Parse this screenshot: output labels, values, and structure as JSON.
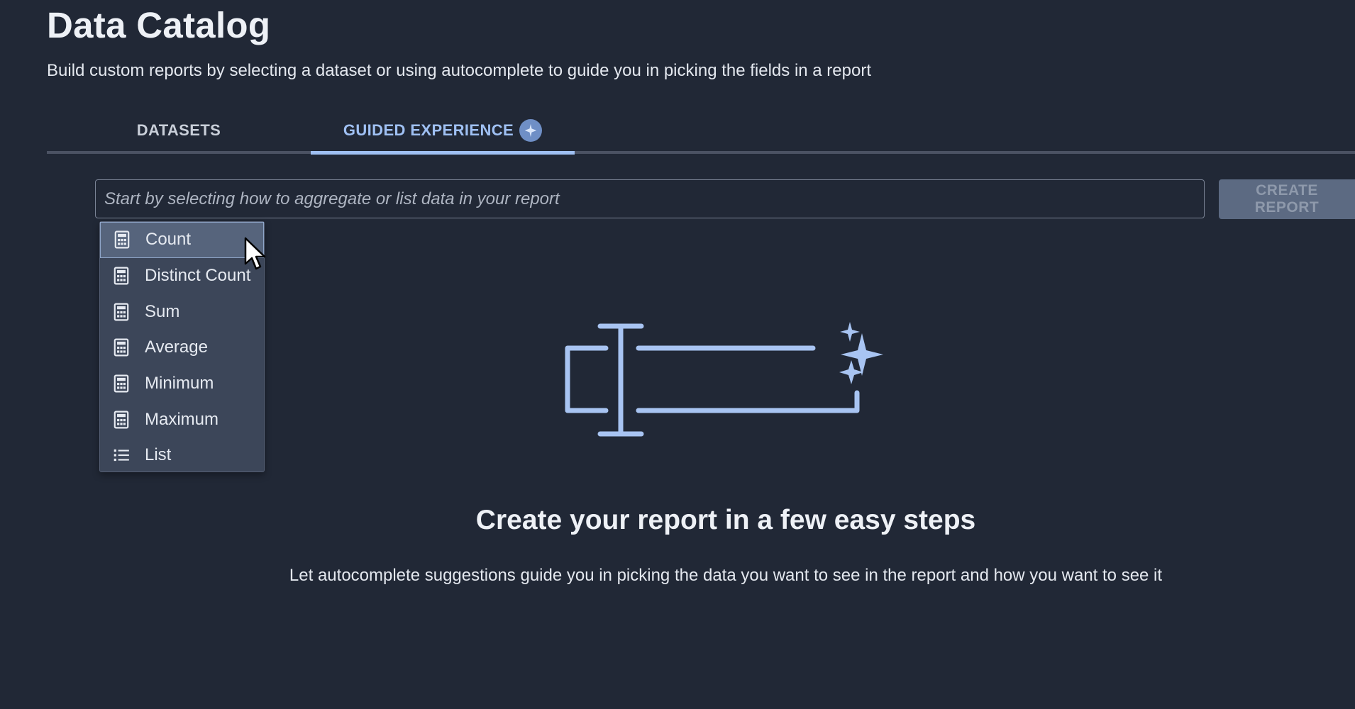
{
  "page": {
    "title": "Data Catalog",
    "subtitle": "Build custom reports by selecting a dataset or using autocomplete to guide you in picking the fields in a report"
  },
  "tabs": [
    {
      "label": "DATASETS",
      "active": false
    },
    {
      "label": "GUIDED EXPERIENCE",
      "active": true,
      "icon": "sparkle-icon"
    }
  ],
  "search": {
    "placeholder": "Start by selecting how to aggregate or list data in your report",
    "value": ""
  },
  "create_button": {
    "label": "CREATE REPORT",
    "disabled": true
  },
  "menu": {
    "items": [
      {
        "label": "Count",
        "icon": "calculator-icon",
        "highlighted": true
      },
      {
        "label": "Distinct Count",
        "icon": "calculator-icon"
      },
      {
        "label": "Sum",
        "icon": "calculator-icon"
      },
      {
        "label": "Average",
        "icon": "calculator-icon"
      },
      {
        "label": "Minimum",
        "icon": "calculator-icon"
      },
      {
        "label": "Maximum",
        "icon": "calculator-icon"
      },
      {
        "label": "List",
        "icon": "list-icon"
      }
    ]
  },
  "empty_state": {
    "illustration": "text-cursor-sparkle-illustration",
    "headline": "Create your report in a few easy steps",
    "description": "Let autocomplete suggestions guide you in picking the data you want to see in the report and how you want to see it"
  },
  "colors": {
    "background": "#212836",
    "accent": "#9fc0f3",
    "menu_background": "#3c4659",
    "button_disabled": "#5c6a82"
  }
}
